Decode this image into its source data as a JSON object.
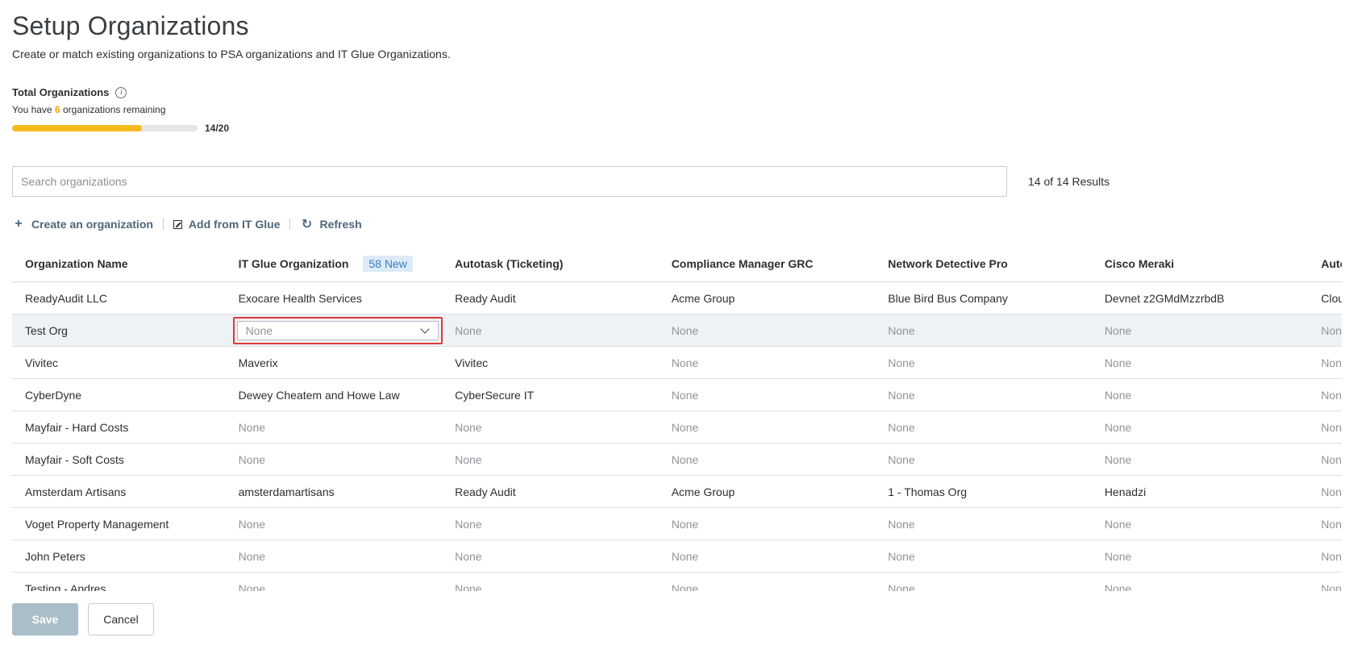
{
  "header": {
    "title": "Setup Organizations",
    "subtitle": "Create or match existing organizations to PSA organizations and IT Glue Organizations."
  },
  "quota": {
    "label": "Total Organizations",
    "remaining_prefix": "You have",
    "remaining_count": "6",
    "remaining_suffix": "organizations remaining",
    "progress_text": "14/20",
    "progress_value": 0.7,
    "progress_color": "#f5bb1d"
  },
  "search": {
    "placeholder": "Search organizations",
    "value": "",
    "results_text": "14 of 14 Results"
  },
  "actions": {
    "create": "Create an organization",
    "add_from_glue": "Add from IT Glue",
    "refresh": "Refresh"
  },
  "table": {
    "columns": [
      "Organization Name",
      "IT Glue Organization",
      "Autotask (Ticketing)",
      "Compliance Manager GRC",
      "Network Detective Pro",
      "Cisco Meraki",
      "Autotask"
    ],
    "new_badge": "58 New",
    "rows": [
      [
        "ReadyAudit LLC",
        "Exocare Health Services",
        "Ready Audit",
        "Acme Group",
        "Blue Bird Bus Company",
        "Devnet z2GMdMzzrbdB",
        "Clouds"
      ],
      [
        "Test Org",
        "None",
        "None",
        "None",
        "None",
        "None",
        "None"
      ],
      [
        "Vivitec",
        "Maverix",
        "Vivitec",
        "None",
        "None",
        "None",
        "None"
      ],
      [
        "CyberDyne",
        "Dewey Cheatem and Howe Law",
        "CyberSecure IT",
        "None",
        "None",
        "None",
        "None"
      ],
      [
        "Mayfair - Hard Costs",
        "None",
        "None",
        "None",
        "None",
        "None",
        "None"
      ],
      [
        "Mayfair - Soft Costs",
        "None",
        "None",
        "None",
        "None",
        "None",
        "None"
      ],
      [
        "Amsterdam Artisans",
        "amsterdamartisans",
        "Ready Audit",
        "Acme Group",
        "1 - Thomas Org",
        "Henadzi",
        "None"
      ],
      [
        "Voget Property Management",
        "None",
        "None",
        "None",
        "None",
        "None",
        "None"
      ],
      [
        "John Peters",
        "None",
        "None",
        "None",
        "None",
        "None",
        "None"
      ],
      [
        "Testing - Andres",
        "None",
        "None",
        "None",
        "None",
        "None",
        "None"
      ]
    ]
  },
  "footer": {
    "save": "Save",
    "cancel": "Cancel"
  }
}
